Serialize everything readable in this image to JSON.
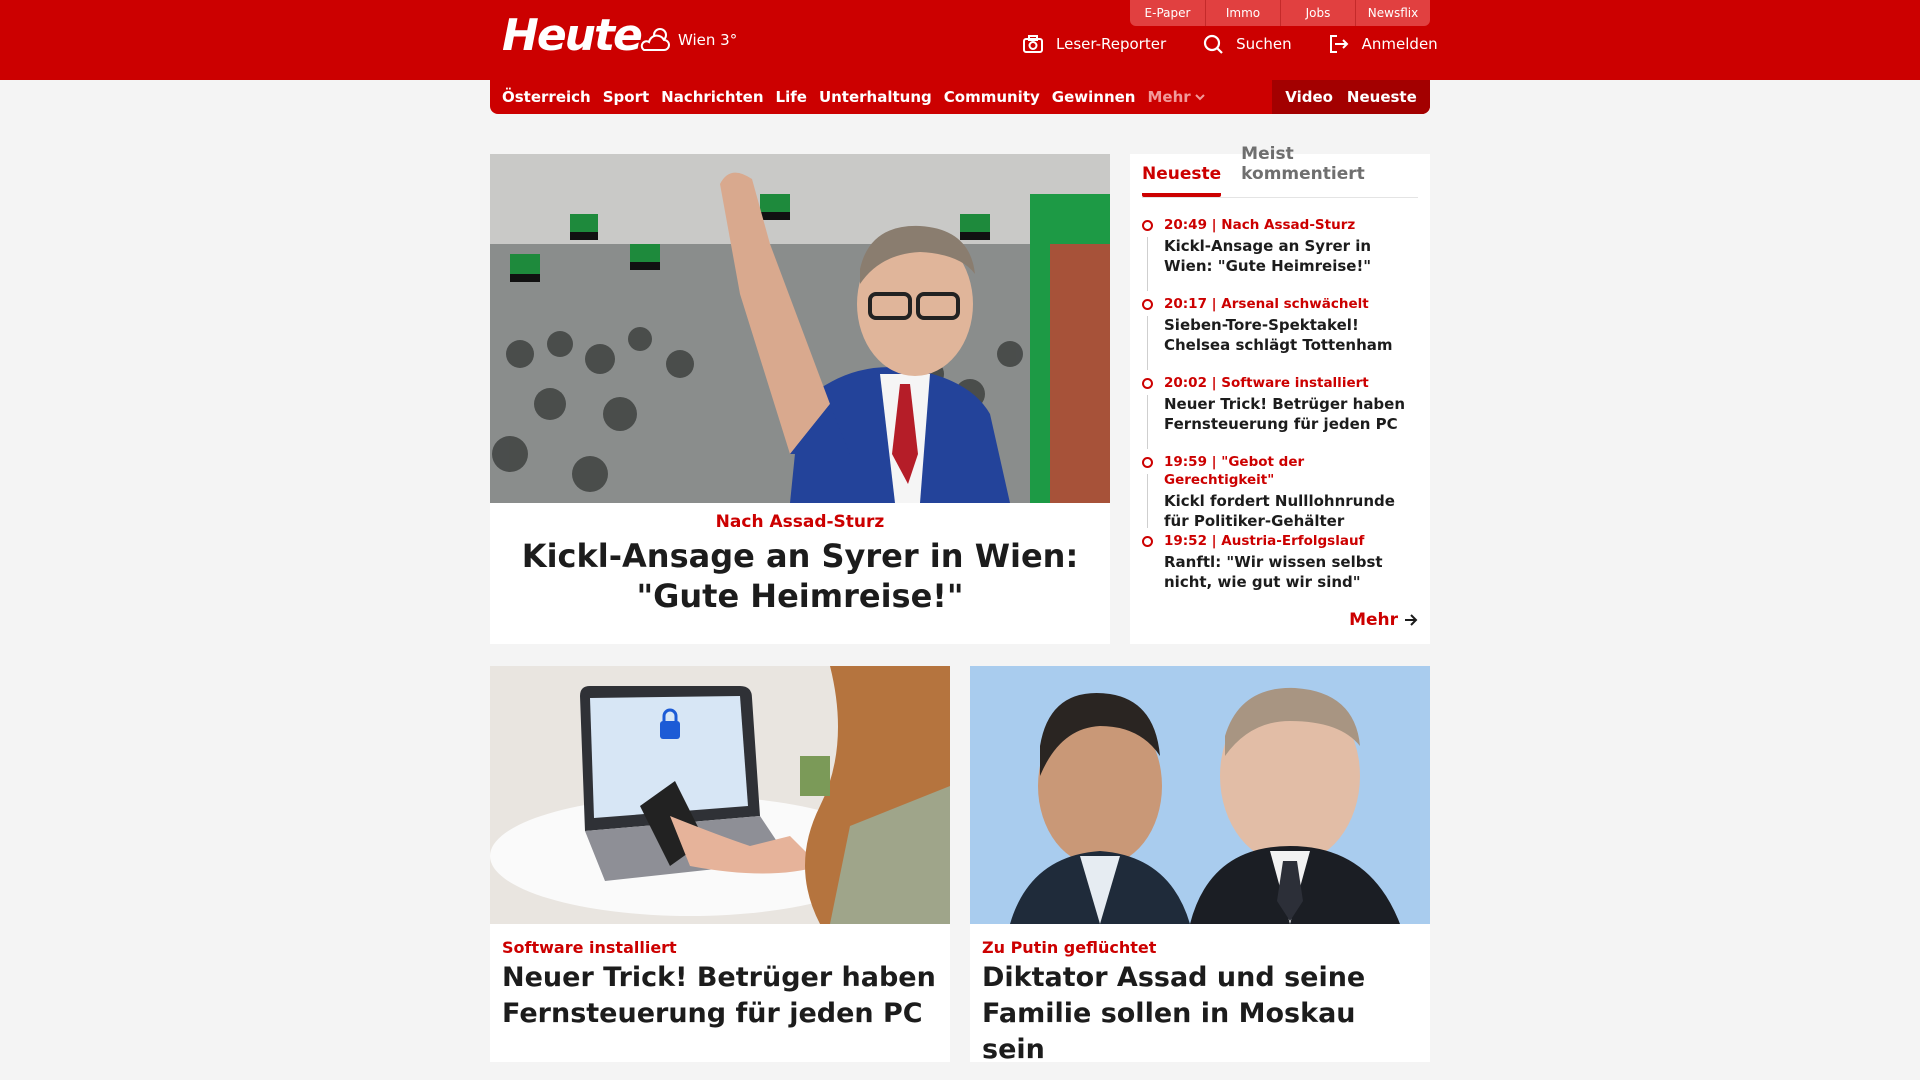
{
  "header": {
    "logo_text": "Heute",
    "weather": {
      "icon": "cloud-sun-icon",
      "label": "Wien 3°"
    },
    "service_tabs": [
      "E-Paper",
      "Immo",
      "Jobs",
      "Newsflix"
    ],
    "actions": [
      {
        "icon": "camera-icon",
        "label": "Leser-Reporter"
      },
      {
        "icon": "search-icon",
        "label": "Suchen"
      },
      {
        "icon": "login-icon",
        "label": "Anmelden"
      }
    ]
  },
  "nav": {
    "items": [
      "Österreich",
      "Sport",
      "Nachrichten",
      "Life",
      "Unterhaltung",
      "Community",
      "Gewinnen"
    ],
    "more_label": "Mehr",
    "right_items": [
      "Video",
      "Neueste"
    ]
  },
  "hero": {
    "kicker": "Nach Assad-Sturz",
    "title": "Kickl-Ansage an Syrer in Wien: \"Gute Heimreise!\""
  },
  "sidebar": {
    "tabs": [
      "Neueste",
      "Meist kommentiert"
    ],
    "active_tab": "Neueste",
    "items": [
      {
        "meta": "20:49 | Nach Assad-Sturz",
        "title": "Kickl-Ansage an Syrer in Wien: \"Gute Heimreise!\""
      },
      {
        "meta": "20:17 | Arsenal schwächelt",
        "title": "Sieben-Tore-Spektakel! Chelsea schlägt Tottenham"
      },
      {
        "meta": "20:02 | Software installiert",
        "title": "Neuer Trick! Betrüger haben Fernsteuerung für jeden PC"
      },
      {
        "meta": "19:59 | \"Gebot der Gerechtigkeit\"",
        "title": "Kickl fordert Nulllohnrunde für Politiker-Gehälter"
      },
      {
        "meta": "19:52 | Austria-Erfolgslauf",
        "title": "Ranftl: \"Wir wissen selbst nicht, wie gut wir sind\""
      }
    ],
    "more_label": "Mehr"
  },
  "cards": [
    {
      "kicker": "Software installiert",
      "title": "Neuer Trick! Betrüger haben Fernsteuerung für jeden PC"
    },
    {
      "kicker": "Zu Putin geflüchtet",
      "title": "Diktator Assad und seine Familie sollen in Moskau sein"
    }
  ],
  "colors": {
    "brand_red": "#cc0000",
    "nav_dark_red": "#a30000",
    "background": "#f4f4f4"
  }
}
